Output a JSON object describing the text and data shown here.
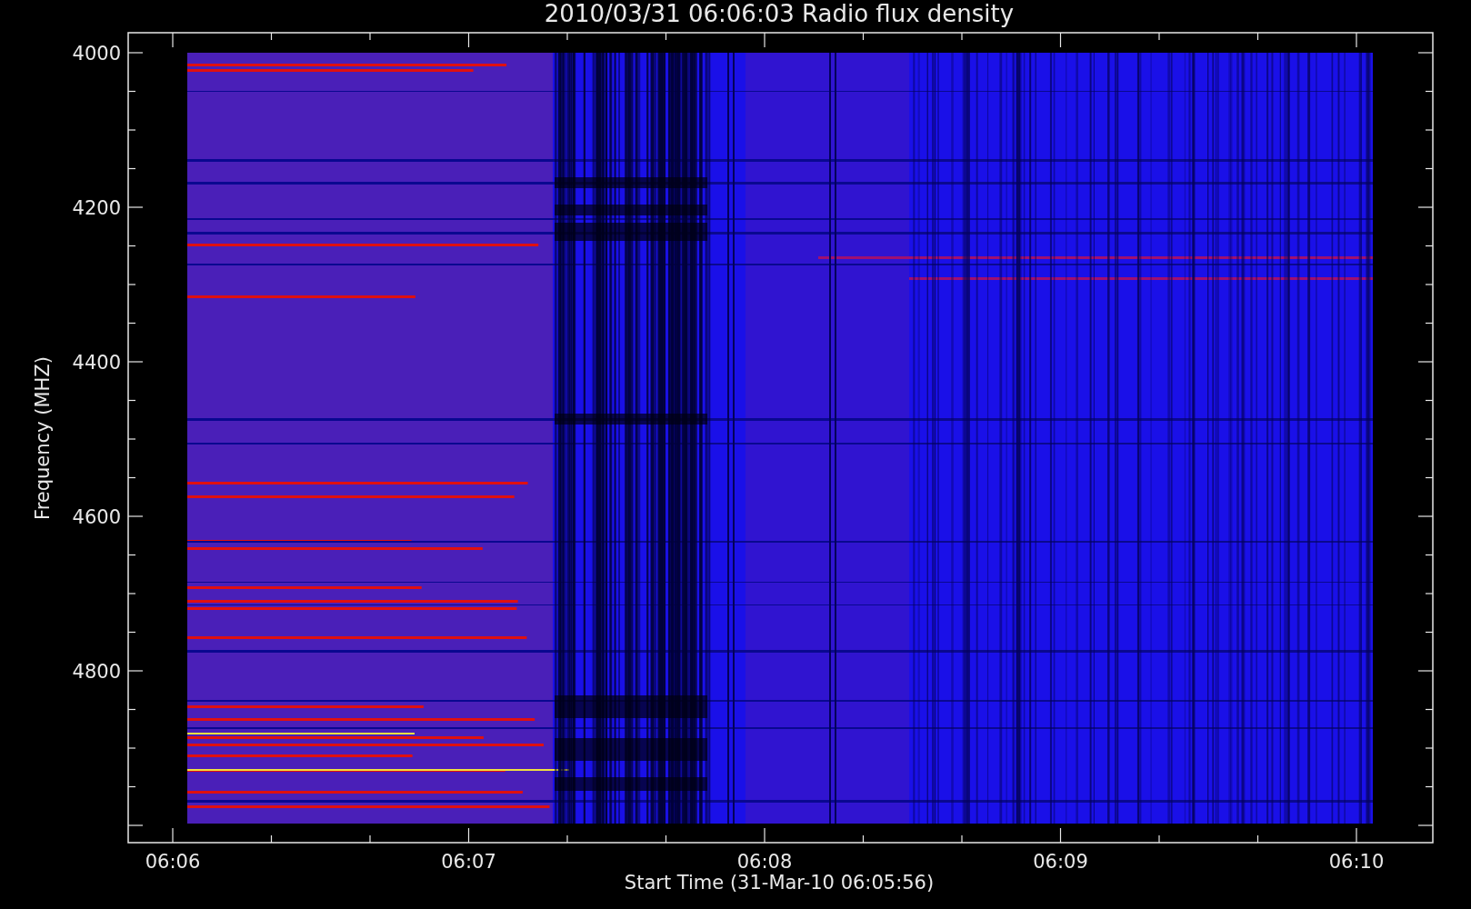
{
  "title": "2010/03/31 06:06:03 Radio flux density",
  "y_axis": {
    "label": "Frequency (MHZ)",
    "ticks": [
      "4000",
      "4200",
      "4400",
      "4600",
      "4800"
    ]
  },
  "x_axis": {
    "label": "Start Time (31-Mar-10 06:05:56)",
    "ticks": [
      "06:06",
      "06:07",
      "06:08",
      "06:09",
      "06:10"
    ]
  }
}
